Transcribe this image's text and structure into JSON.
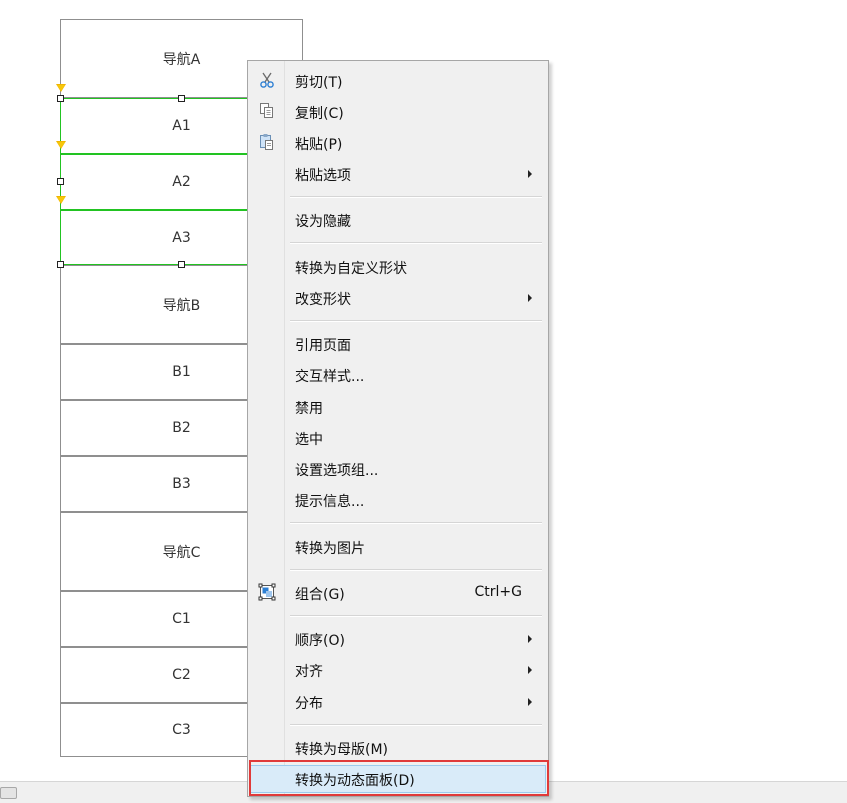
{
  "nav": {
    "cells": [
      {
        "label": "导航A"
      },
      {
        "label": "A1"
      },
      {
        "label": "A2"
      },
      {
        "label": "A3"
      },
      {
        "label": "导航B"
      },
      {
        "label": "B1"
      },
      {
        "label": "B2"
      },
      {
        "label": "B3"
      },
      {
        "label": "导航C"
      },
      {
        "label": "C1"
      },
      {
        "label": "C2"
      },
      {
        "label": "C3"
      }
    ]
  },
  "menu": {
    "cut": "剪切(T)",
    "copy": "复制(C)",
    "paste": "粘贴(P)",
    "paste_options": "粘贴选项",
    "set_hidden": "设为隐藏",
    "convert_custom_shape": "转换为自定义形状",
    "change_shape": "改变形状",
    "reference_page": "引用页面",
    "interaction_style": "交互样式...",
    "disable": "禁用",
    "selected": "选中",
    "set_option_group": "设置选项组...",
    "tooltip": "提示信息...",
    "convert_image": "转换为图片",
    "group": "组合(G)",
    "group_shortcut": "Ctrl+G",
    "order": "顺序(O)",
    "align": "对齐",
    "distribute": "分布",
    "convert_master": "转换为母版(M)",
    "convert_dynamic_panel": "转换为动态面板(D)"
  },
  "colors": {
    "selection_green": "#22c322",
    "highlight_bg": "#d9ebf9",
    "annotation_red": "#e03a3a"
  }
}
